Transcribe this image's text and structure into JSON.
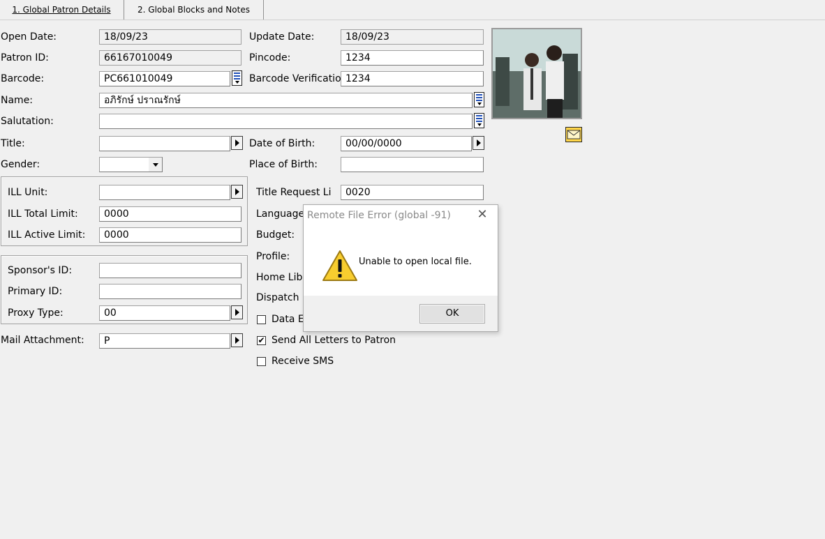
{
  "tabs": [
    {
      "label": "1. Global Patron Details",
      "active": true
    },
    {
      "label": "2. Global Blocks and Notes",
      "active": false
    }
  ],
  "form": {
    "open_date": {
      "label": "Open Date:",
      "value": "18/09/23"
    },
    "update_date": {
      "label": "Update Date:",
      "value": "18/09/23"
    },
    "patron_id": {
      "label": "Patron ID:",
      "value": "66167010049"
    },
    "pincode": {
      "label": "Pincode:",
      "value": "1234"
    },
    "barcode": {
      "label": "Barcode:",
      "value": "PC661010049"
    },
    "barcode_verification": {
      "label": "Barcode Verificatio",
      "value": "1234"
    },
    "name": {
      "label": "Name:",
      "value": "อภิรักษ์ ปราณรักษ์"
    },
    "salutation": {
      "label": "Salutation:",
      "value": ""
    },
    "title": {
      "label": "Title:",
      "value": ""
    },
    "date_of_birth": {
      "label": "Date of Birth:",
      "value": "00/00/0000"
    },
    "gender": {
      "label": "Gender:",
      "value": ""
    },
    "place_of_birth": {
      "label": "Place of Birth:",
      "value": ""
    },
    "ill_unit": {
      "label": "ILL Unit:",
      "value": ""
    },
    "title_request_limit": {
      "label": "Title Request Li",
      "value": "0020"
    },
    "ill_total_limit": {
      "label": "ILL Total Limit:",
      "value": "0000"
    },
    "language": {
      "label": "Language"
    },
    "ill_active_limit": {
      "label": "ILL Active Limit:",
      "value": "0000"
    },
    "budget": {
      "label": "Budget:"
    },
    "profile": {
      "label": "Profile:"
    },
    "sponsor_id": {
      "label": "Sponsor's ID:",
      "value": ""
    },
    "home_library": {
      "label": "Home Libr"
    },
    "primary_id": {
      "label": "Primary ID:",
      "value": ""
    },
    "dispatch": {
      "label": "Dispatch I"
    },
    "proxy_type": {
      "label": "Proxy Type:",
      "value": "00"
    },
    "data_e": {
      "label": "Data E",
      "checked": false
    },
    "mail_attachment": {
      "label": "Mail Attachment:",
      "value": "P"
    },
    "send_all_letters": {
      "label": "Send All Letters to Patron",
      "checked": true
    },
    "receive_sms": {
      "label": "Receive SMS",
      "checked": false
    }
  },
  "dialog": {
    "title": "Remote File Error (global -91)",
    "message": "Unable to open local file.",
    "ok_label": "OK",
    "close_glyph": "✕"
  },
  "icons": {
    "warning": "warning-icon",
    "mail": "mail-icon",
    "list": "list-icon"
  }
}
